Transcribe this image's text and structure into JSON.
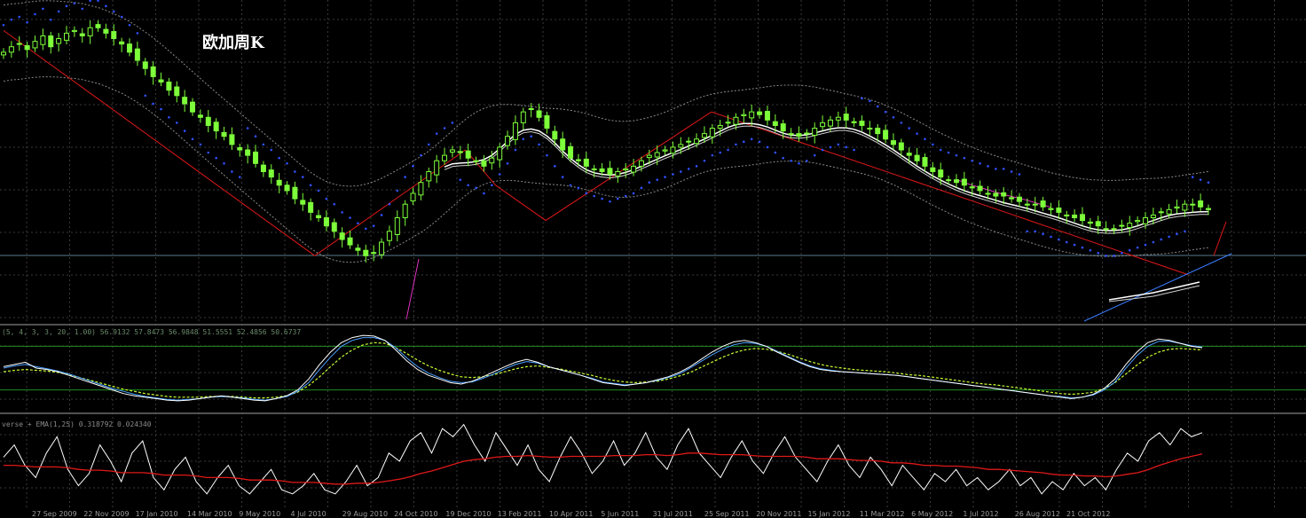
{
  "window": {
    "title": "欧加周K"
  },
  "colors": {
    "background": "#000000",
    "grid": "#3a3a3a",
    "candle": "#7dff3a",
    "sar": "#3050ff",
    "trend": "#e01818",
    "ma_fast": "#ffffff",
    "ma_slow": "#d0d0d0",
    "ma_pink": "#e030c0",
    "envelope": "#8a8a8a",
    "stoch_k": "#ffffff",
    "stoch_d": "#4aa0ff",
    "stoch_signal": "#c8ff30",
    "stoch_level": "#1f8f1f",
    "separator": "#6a6a6a",
    "rsi_line": "#ffffff",
    "rsi_ema": "#e01818",
    "channel_blue": "#3a7cff",
    "divider_line": "#5a7a8a"
  },
  "indicators": {
    "stoch_label": "(5, 4, 3, 3, 20, 1.00) 56.9132 57.8473 56.9848 51.5551 52.4856 50.6737",
    "lower_label": "verse + EMA(1,25) 0.318792 0.024340"
  },
  "chart_data": {
    "type": "line",
    "title": "欧加周K",
    "xlabel": "",
    "ylabel": "",
    "grid": true,
    "x_ticks": [
      "27 Sep 2009",
      "22 Nov 2009",
      "17 Jan 2010",
      "14 Mar 2010",
      "9 May 2010",
      "4 Jul 2010",
      "29 Aug 2010",
      "24 Oct 2010",
      "19 Dec 2010",
      "13 Feb 2011",
      "10 Apr 2011",
      "5 Jun 2011",
      "31 Jul 2011",
      "25 Sep 2011",
      "20 Nov 2011",
      "15 Jan 2012",
      "11 Mar 2012",
      "6 May 2012",
      "1 Jul 2012",
      "26 Aug 2012",
      "21 Oct 2012"
    ],
    "price_series": {
      "name": "",
      "ylim": [
        0,
        100
      ],
      "close": [
        86,
        88,
        89,
        87,
        90,
        92,
        88,
        91,
        93,
        94,
        92,
        95,
        95,
        93,
        91,
        89,
        86,
        83,
        80,
        77,
        75,
        72,
        70,
        67,
        64,
        62,
        59,
        57,
        55,
        52,
        50,
        48,
        45,
        42,
        40,
        37,
        35,
        32,
        30,
        27,
        25,
        22,
        20,
        17,
        15,
        13,
        11,
        12,
        16,
        20,
        25,
        30,
        34,
        38,
        42,
        46,
        48,
        50,
        49,
        47,
        46,
        44,
        47,
        51,
        55,
        60,
        64,
        65,
        62,
        58,
        54,
        50,
        47,
        46,
        44,
        43,
        42,
        41,
        42,
        43,
        44,
        46,
        48,
        49,
        50,
        51,
        52,
        53,
        54,
        56,
        58,
        59,
        60,
        62,
        63,
        64,
        63,
        61,
        59,
        57,
        56,
        55,
        56,
        58,
        60,
        61,
        62,
        61,
        60,
        59,
        58,
        56,
        54,
        52,
        50,
        48,
        46,
        44,
        42,
        40,
        39,
        38,
        37,
        36,
        35,
        34,
        33,
        33,
        32,
        31,
        30,
        30,
        29,
        28,
        27,
        26,
        25,
        24,
        23,
        22,
        21,
        21,
        22,
        23,
        24,
        25,
        26,
        27,
        28,
        29,
        30,
        30,
        29,
        28
      ],
      "sar_above_until": 58
    },
    "trend_lines": [
      {
        "name": "",
        "points": [
          [
            0,
            94
          ],
          [
            62,
            11
          ]
        ]
      },
      {
        "name": "",
        "points": [
          [
            62,
            11
          ],
          [
            92,
            50
          ]
        ]
      },
      {
        "name": "",
        "points": [
          [
            92,
            50
          ],
          [
            98,
            37
          ]
        ]
      },
      {
        "name": "",
        "points": [
          [
            98,
            37
          ],
          [
            108,
            24
          ]
        ]
      },
      {
        "name": "",
        "points": [
          [
            108,
            24
          ],
          [
            141,
            64
          ]
        ]
      },
      {
        "name": "",
        "points": [
          [
            141,
            64
          ],
          [
            236,
            4
          ]
        ]
      }
    ],
    "stochastic": {
      "ylim": [
        0,
        100
      ],
      "levels": [
        80,
        20
      ],
      "k": [
        52,
        55,
        58,
        50,
        48,
        45,
        40,
        35,
        30,
        25,
        20,
        15,
        12,
        10,
        8,
        6,
        5,
        6,
        8,
        10,
        12,
        10,
        8,
        6,
        5,
        8,
        12,
        20,
        35,
        55,
        72,
        85,
        92,
        95,
        94,
        88,
        75,
        60,
        48,
        40,
        35,
        30,
        28,
        32,
        38,
        45,
        52,
        58,
        62,
        58,
        52,
        48,
        44,
        40,
        35,
        30,
        28,
        26,
        28,
        30,
        34,
        38,
        44,
        52,
        62,
        72,
        80,
        86,
        88,
        85,
        80,
        72,
        65,
        58,
        52,
        48,
        46,
        45,
        44,
        43,
        42,
        41,
        40,
        38,
        36,
        34,
        32,
        30,
        28,
        26,
        24,
        22,
        20,
        18,
        16,
        14,
        12,
        10,
        8,
        10,
        14,
        22,
        35,
        55,
        72,
        85,
        90,
        88,
        84,
        80,
        78
      ],
      "d": [
        50,
        53,
        55,
        52,
        49,
        46,
        42,
        37,
        32,
        27,
        22,
        18,
        14,
        11,
        9,
        7,
        6,
        7,
        8,
        10,
        11,
        10,
        9,
        7,
        6,
        8,
        11,
        18,
        30,
        48,
        65,
        80,
        88,
        92,
        92,
        88,
        78,
        64,
        52,
        43,
        37,
        32,
        30,
        31,
        36,
        42,
        49,
        55,
        59,
        57,
        52,
        48,
        44,
        40,
        36,
        31,
        29,
        27,
        28,
        30,
        33,
        37,
        42,
        50,
        59,
        68,
        76,
        82,
        85,
        84,
        80,
        73,
        66,
        59,
        53,
        49,
        47,
        45,
        44,
        43,
        42,
        41,
        40,
        38,
        36,
        34,
        32,
        30,
        28,
        26,
        24,
        22,
        20,
        18,
        16,
        14,
        12,
        11,
        9,
        10,
        13,
        20,
        31,
        50,
        67,
        80,
        87,
        87,
        84,
        81,
        79
      ],
      "signal": [
        45,
        47,
        48,
        47,
        46,
        44,
        41,
        37,
        33,
        29,
        25,
        21,
        18,
        15,
        13,
        11,
        10,
        10,
        10,
        11,
        11,
        11,
        10,
        9,
        9,
        10,
        12,
        17,
        26,
        38,
        52,
        65,
        75,
        82,
        85,
        84,
        78,
        70,
        61,
        53,
        47,
        42,
        38,
        37,
        38,
        41,
        45,
        49,
        52,
        53,
        51,
        49,
        46,
        43,
        40,
        36,
        33,
        31,
        30,
        31,
        32,
        35,
        39,
        44,
        51,
        58,
        65,
        71,
        75,
        77,
        76,
        73,
        69,
        64,
        59,
        55,
        52,
        50,
        48,
        47,
        46,
        45,
        43,
        41,
        40,
        38,
        36,
        34,
        32,
        30,
        28,
        27,
        25,
        23,
        21,
        19,
        17,
        15,
        14,
        15,
        17,
        22,
        30,
        42,
        54,
        65,
        72,
        76,
        77,
        76,
        75
      ]
    },
    "lower_indicator": {
      "ylim": [
        0,
        100
      ],
      "line": [
        55,
        70,
        45,
        30,
        60,
        80,
        40,
        20,
        35,
        70,
        50,
        25,
        60,
        75,
        30,
        15,
        40,
        55,
        25,
        10,
        30,
        45,
        20,
        10,
        25,
        40,
        15,
        10,
        20,
        35,
        15,
        10,
        25,
        45,
        20,
        30,
        60,
        50,
        75,
        85,
        60,
        90,
        80,
        95,
        70,
        50,
        85,
        65,
        45,
        70,
        40,
        25,
        55,
        80,
        60,
        35,
        50,
        75,
        45,
        60,
        85,
        55,
        40,
        70,
        90,
        60,
        45,
        30,
        55,
        75,
        50,
        35,
        60,
        80,
        55,
        40,
        25,
        50,
        70,
        45,
        30,
        55,
        40,
        20,
        45,
        30,
        15,
        35,
        25,
        40,
        20,
        30,
        15,
        25,
        40,
        20,
        30,
        10,
        25,
        15,
        35,
        20,
        30,
        15,
        40,
        60,
        50,
        75,
        85,
        70,
        90,
        80,
        85
      ],
      "ema": [
        45,
        45,
        44,
        43,
        43,
        43,
        42,
        40,
        39,
        39,
        38,
        36,
        36,
        36,
        35,
        33,
        33,
        33,
        32,
        30,
        30,
        30,
        29,
        27,
        27,
        27,
        26,
        24,
        24,
        24,
        23,
        22,
        22,
        23,
        23,
        24,
        26,
        28,
        31,
        35,
        38,
        42,
        46,
        50,
        52,
        53,
        55,
        56,
        56,
        57,
        56,
        55,
        55,
        56,
        56,
        56,
        56,
        57,
        57,
        57,
        58,
        58,
        57,
        58,
        60,
        60,
        59,
        58,
        58,
        58,
        57,
        56,
        56,
        56,
        56,
        55,
        53,
        53,
        53,
        52,
        51,
        51,
        50,
        48,
        48,
        47,
        45,
        45,
        44,
        44,
        43,
        42,
        40,
        40,
        39,
        38,
        37,
        36,
        34,
        33,
        33,
        32,
        32,
        31,
        32,
        34,
        36,
        40,
        45,
        49,
        53,
        56,
        59
      ]
    }
  }
}
